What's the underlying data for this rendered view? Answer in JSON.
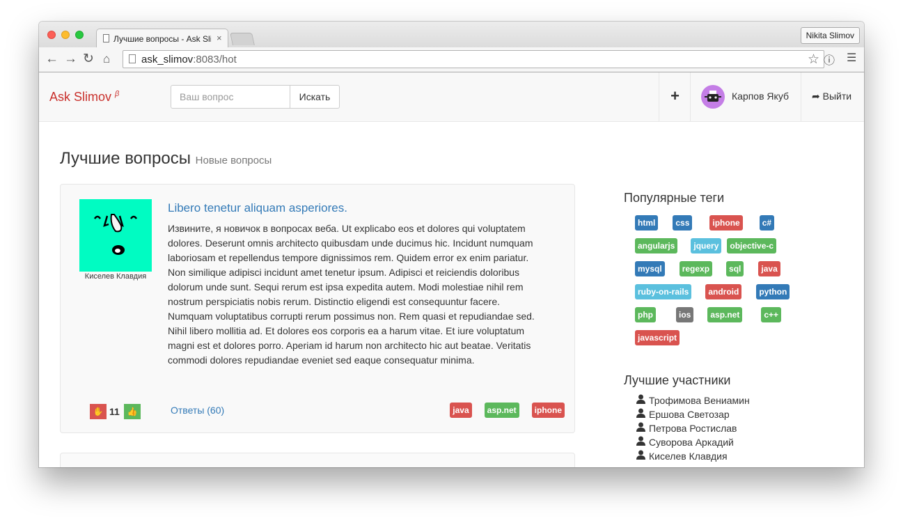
{
  "browser": {
    "tab_title": "Лучшие вопросы - Ask Slimov",
    "tab_close": "×",
    "profile_name": "Nikita Slimov",
    "url_host": "ask_slimov",
    "url_rest": ":8083/hot",
    "nav_icons": [
      "back-icon",
      "forward-icon",
      "reload-icon",
      "home-icon"
    ],
    "toolbar_icons": [
      "star-icon",
      "info-icon",
      "menu-icon"
    ]
  },
  "navbar": {
    "brand": "Ask Slimov",
    "brand_sup": "β",
    "search_placeholder": "Ваш вопрос",
    "search_button": "Искать",
    "add_button": "+",
    "user_name": "Карпов Якуб",
    "logout": "Выйти"
  },
  "heading": {
    "title": "Лучшие вопросы",
    "subtitle": "Новые вопросы"
  },
  "question": {
    "title": "Libero tenetur aliquam asperiores.",
    "author": "Киселев Клавдия",
    "body": "Извините, я новичок в вопросах веба. Ut explicabo eos et dolores qui voluptatem dolores. Deserunt omnis architecto quibusdam unde ducimus hic. Incidunt numquam laboriosam et repellendus tempore dignissimos rem. Quidem error ex enim pariatur. Non similique adipisci incidunt amet tenetur ipsum. Adipisci et reiciendis doloribus dolorum unde sunt. Sequi rerum est ipsa expedita autem. Modi molestiae nihil rem nostrum perspiciatis nobis rerum. Distinctio eligendi est consequuntur facere. Numquam voluptatibus corrupti rerum possimus non. Rem quasi et repudiandae sed. Nihil libero mollitia ad. Et dolores eos corporis ea a harum vitae. Et iure voluptatum magni est et dolores porro. Aperiam id harum non architecto hic aut beatae. Veritatis commodi dolores repudiandae eveniet sed eaque consequatur minima.",
    "score": "11",
    "answers": "Ответы (60)",
    "tags": [
      {
        "name": "java",
        "color": "#d9534f"
      },
      {
        "name": "asp.net",
        "color": "#5cb85c"
      },
      {
        "name": "iphone",
        "color": "#d9534f"
      }
    ]
  },
  "sidebar": {
    "tags_title": "Популярные теги",
    "tags": [
      {
        "name": "html",
        "color": "#337ab7"
      },
      {
        "name": "css",
        "color": "#337ab7"
      },
      {
        "name": "iphone",
        "color": "#d9534f"
      },
      {
        "name": "c#",
        "color": "#337ab7"
      },
      {
        "name": "angularjs",
        "color": "#5cb85c"
      },
      {
        "name": "jquery",
        "color": "#5bc0de"
      },
      {
        "name": "objective-c",
        "color": "#5cb85c"
      },
      {
        "name": "mysql",
        "color": "#337ab7"
      },
      {
        "name": "regexp",
        "color": "#5cb85c"
      },
      {
        "name": "sql",
        "color": "#5cb85c"
      },
      {
        "name": "java",
        "color": "#d9534f"
      },
      {
        "name": "ruby-on-rails",
        "color": "#5bc0de"
      },
      {
        "name": "android",
        "color": "#d9534f"
      },
      {
        "name": "python",
        "color": "#337ab7"
      },
      {
        "name": "php",
        "color": "#5cb85c"
      },
      {
        "name": "ios",
        "color": "#777777"
      },
      {
        "name": "asp.net",
        "color": "#5cb85c"
      },
      {
        "name": "c++",
        "color": "#5cb85c"
      },
      {
        "name": "javascript",
        "color": "#d9534f"
      }
    ],
    "users_title": "Лучшие участники",
    "users": [
      "Трофимова Вениамин",
      "Ершова Светозар",
      "Петрова Ростислав",
      "Суворова Аркадий",
      "Киселев Клавдия"
    ]
  }
}
